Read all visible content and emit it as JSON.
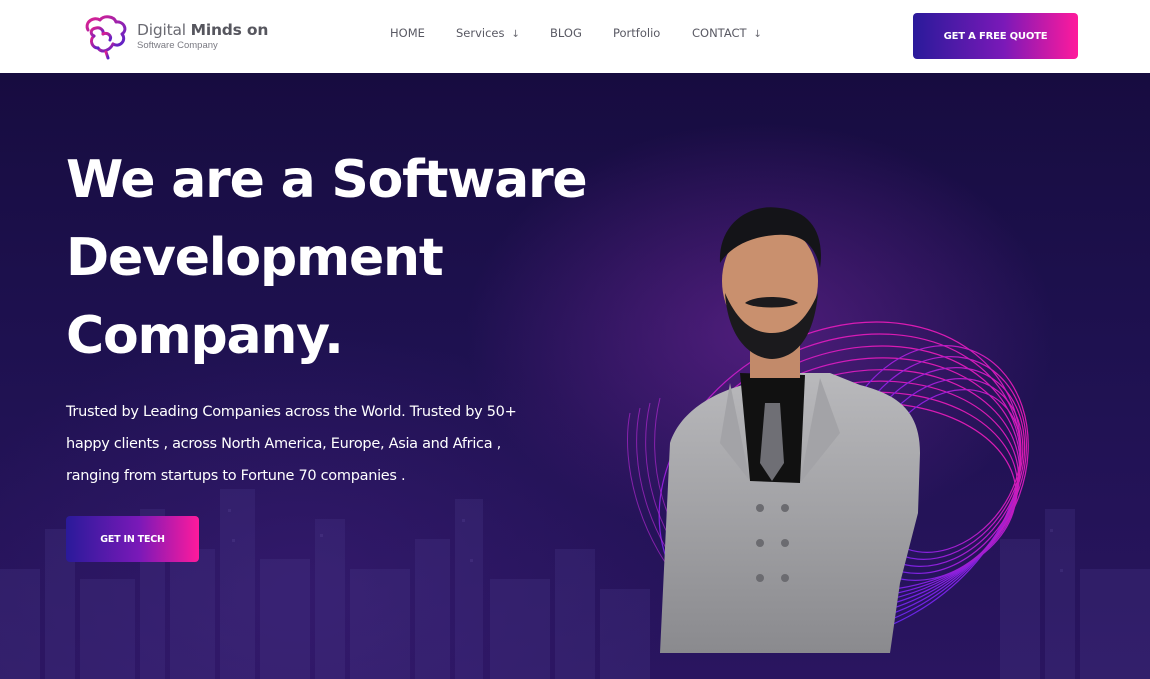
{
  "brand": {
    "name_light": "Digital ",
    "name_bold": "Minds on",
    "tagline": "Software Company",
    "colors": {
      "primary": "#2a1a9a",
      "accent": "#ff1a9c",
      "purple": "#7a19b8"
    }
  },
  "nav": {
    "items": [
      {
        "label": "HOME",
        "has_dropdown": false
      },
      {
        "label": "Services",
        "has_dropdown": true
      },
      {
        "label": "BLOG",
        "has_dropdown": false
      },
      {
        "label": "Portfolio",
        "has_dropdown": false
      },
      {
        "label": "CONTACT",
        "has_dropdown": true
      }
    ],
    "dropdown_glyph": "↓",
    "cta_label": "GET A FREE QUOTE"
  },
  "hero": {
    "heading_lines": [
      "We are a Software",
      "Development",
      "Company."
    ],
    "description_lines": [
      "Trusted by Leading Companies across the World. Trusted by 50+",
      "happy clients , across North America, Europe, Asia and Africa ,",
      "ranging from startups to Fortune 70 companies ."
    ],
    "cta_label": "GET IN TECH"
  },
  "icons": {
    "logo": "brain-logo-icon",
    "dropdown": "arrow-down-icon"
  }
}
